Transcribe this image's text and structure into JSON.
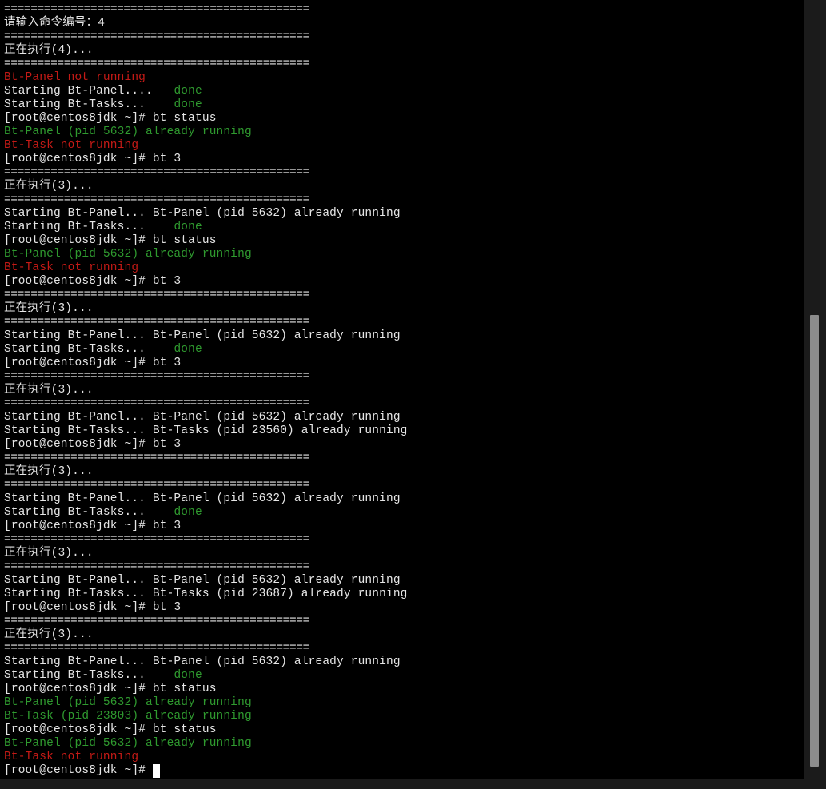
{
  "terminal": {
    "prompt": "[root@centos8jdk ~]# ",
    "colors": {
      "background": "#000000",
      "default_text": "#e6e6e6",
      "error_red": "#c41a16",
      "success_green": "#2f9a2f",
      "scrollbar_thumb": "#8c8c8c"
    },
    "scrollbar": {
      "thumb_start_fraction": 0.405,
      "thumb_length_fraction": 0.58
    },
    "lines": [
      [
        {
          "t": "==============================================",
          "c": "w"
        }
      ],
      [
        {
          "t": "请输入命令编号：4",
          "c": "w"
        }
      ],
      [
        {
          "t": "==============================================",
          "c": "w"
        }
      ],
      [
        {
          "t": "正在执行(4)...",
          "c": "w"
        }
      ],
      [
        {
          "t": "==============================================",
          "c": "w"
        }
      ],
      [
        {
          "t": "Bt-Panel not running",
          "c": "r"
        }
      ],
      [
        {
          "t": "Starting Bt-Panel....   ",
          "c": "w"
        },
        {
          "t": "done",
          "c": "g"
        }
      ],
      [
        {
          "t": "Starting Bt-Tasks...    ",
          "c": "w"
        },
        {
          "t": "done",
          "c": "g"
        }
      ],
      [
        {
          "t": "[root@centos8jdk ~]# bt status",
          "c": "w"
        }
      ],
      [
        {
          "t": "Bt-Panel (pid 5632) already running",
          "c": "g"
        }
      ],
      [
        {
          "t": "Bt-Task not running",
          "c": "r"
        }
      ],
      [
        {
          "t": "[root@centos8jdk ~]# bt 3",
          "c": "w"
        }
      ],
      [
        {
          "t": "==============================================",
          "c": "w"
        }
      ],
      [
        {
          "t": "正在执行(3)...",
          "c": "w"
        }
      ],
      [
        {
          "t": "==============================================",
          "c": "w"
        }
      ],
      [
        {
          "t": "Starting Bt-Panel... Bt-Panel (pid 5632) already running",
          "c": "w"
        }
      ],
      [
        {
          "t": "Starting Bt-Tasks...    ",
          "c": "w"
        },
        {
          "t": "done",
          "c": "g"
        }
      ],
      [
        {
          "t": "[root@centos8jdk ~]# bt status",
          "c": "w"
        }
      ],
      [
        {
          "t": "Bt-Panel (pid 5632) already running",
          "c": "g"
        }
      ],
      [
        {
          "t": "Bt-Task not running",
          "c": "r"
        }
      ],
      [
        {
          "t": "[root@centos8jdk ~]# bt 3",
          "c": "w"
        }
      ],
      [
        {
          "t": "==============================================",
          "c": "w"
        }
      ],
      [
        {
          "t": "正在执行(3)...",
          "c": "w"
        }
      ],
      [
        {
          "t": "==============================================",
          "c": "w"
        }
      ],
      [
        {
          "t": "Starting Bt-Panel... Bt-Panel (pid 5632) already running",
          "c": "w"
        }
      ],
      [
        {
          "t": "Starting Bt-Tasks...    ",
          "c": "w"
        },
        {
          "t": "done",
          "c": "g"
        }
      ],
      [
        {
          "t": "[root@centos8jdk ~]# bt 3",
          "c": "w"
        }
      ],
      [
        {
          "t": "==============================================",
          "c": "w"
        }
      ],
      [
        {
          "t": "正在执行(3)...",
          "c": "w"
        }
      ],
      [
        {
          "t": "==============================================",
          "c": "w"
        }
      ],
      [
        {
          "t": "Starting Bt-Panel... Bt-Panel (pid 5632) already running",
          "c": "w"
        }
      ],
      [
        {
          "t": "Starting Bt-Tasks... Bt-Tasks (pid 23560) already running",
          "c": "w"
        }
      ],
      [
        {
          "t": "[root@centos8jdk ~]# bt 3",
          "c": "w"
        }
      ],
      [
        {
          "t": "==============================================",
          "c": "w"
        }
      ],
      [
        {
          "t": "正在执行(3)...",
          "c": "w"
        }
      ],
      [
        {
          "t": "==============================================",
          "c": "w"
        }
      ],
      [
        {
          "t": "Starting Bt-Panel... Bt-Panel (pid 5632) already running",
          "c": "w"
        }
      ],
      [
        {
          "t": "Starting Bt-Tasks...    ",
          "c": "w"
        },
        {
          "t": "done",
          "c": "g"
        }
      ],
      [
        {
          "t": "[root@centos8jdk ~]# bt 3",
          "c": "w"
        }
      ],
      [
        {
          "t": "==============================================",
          "c": "w"
        }
      ],
      [
        {
          "t": "正在执行(3)...",
          "c": "w"
        }
      ],
      [
        {
          "t": "==============================================",
          "c": "w"
        }
      ],
      [
        {
          "t": "Starting Bt-Panel... Bt-Panel (pid 5632) already running",
          "c": "w"
        }
      ],
      [
        {
          "t": "Starting Bt-Tasks... Bt-Tasks (pid 23687) already running",
          "c": "w"
        }
      ],
      [
        {
          "t": "[root@centos8jdk ~]# bt 3",
          "c": "w"
        }
      ],
      [
        {
          "t": "==============================================",
          "c": "w"
        }
      ],
      [
        {
          "t": "正在执行(3)...",
          "c": "w"
        }
      ],
      [
        {
          "t": "==============================================",
          "c": "w"
        }
      ],
      [
        {
          "t": "Starting Bt-Panel... Bt-Panel (pid 5632) already running",
          "c": "w"
        }
      ],
      [
        {
          "t": "Starting Bt-Tasks...    ",
          "c": "w"
        },
        {
          "t": "done",
          "c": "g"
        }
      ],
      [
        {
          "t": "[root@centos8jdk ~]# bt status",
          "c": "w"
        }
      ],
      [
        {
          "t": "Bt-Panel (pid 5632) already running",
          "c": "g"
        }
      ],
      [
        {
          "t": "Bt-Task (pid 23803) already running",
          "c": "g"
        }
      ],
      [
        {
          "t": "[root@centos8jdk ~]# bt status",
          "c": "w"
        }
      ],
      [
        {
          "t": "Bt-Panel (pid 5632) already running",
          "c": "g"
        }
      ],
      [
        {
          "t": "Bt-Task not running",
          "c": "r"
        }
      ]
    ]
  }
}
